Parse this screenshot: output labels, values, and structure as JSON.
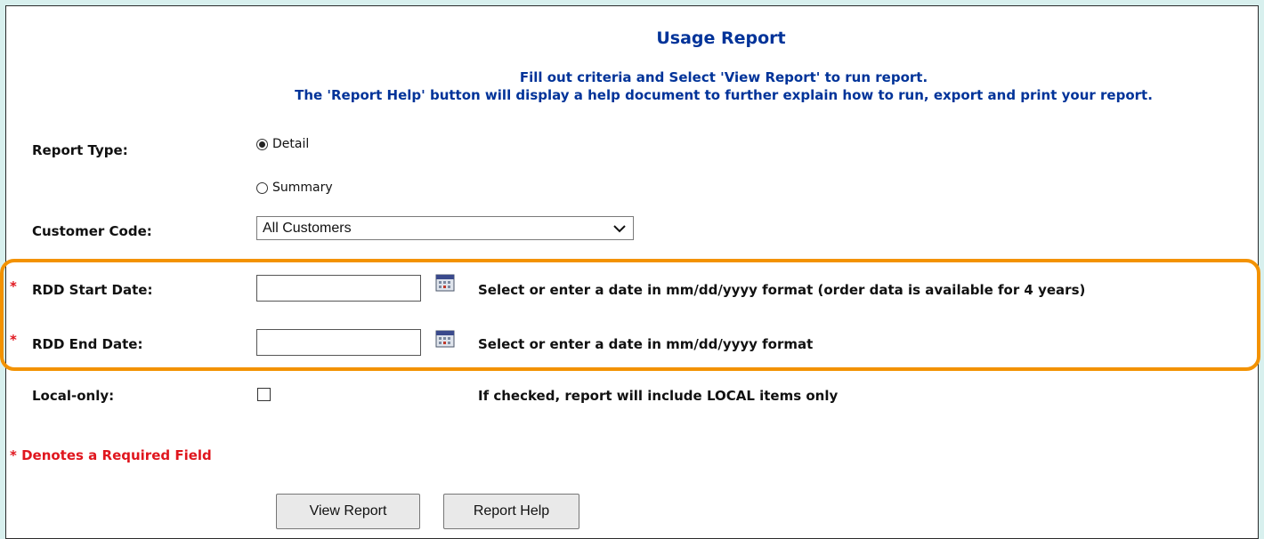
{
  "header": {
    "title": "Usage Report",
    "subtitle_line1": "Fill out criteria and Select 'View Report' to run report.",
    "subtitle_line2": "The 'Report Help' button will display a help document to further explain how to run, export and print your report."
  },
  "form": {
    "report_type": {
      "label": "Report Type:",
      "options": [
        "Detail",
        "Summary"
      ],
      "selected": "Detail"
    },
    "customer_code": {
      "label": "Customer Code:",
      "value": "All Customers"
    },
    "rdd_start": {
      "label": "RDD Start Date:",
      "required_marker": "*",
      "value": "",
      "hint": "Select or enter a date in mm/dd/yyyy format (order data is available for 4 years)"
    },
    "rdd_end": {
      "label": "RDD End Date:",
      "required_marker": "*",
      "value": "",
      "hint": "Select or enter a date in mm/dd/yyyy format"
    },
    "local_only": {
      "label": "Local-only:",
      "checked": false,
      "hint": "If checked, report will include LOCAL items only"
    }
  },
  "required_note": "* Denotes a Required Field",
  "buttons": {
    "view_report": "View Report",
    "report_help": "Report Help"
  },
  "colors": {
    "background": "#d8f0ee",
    "title_blue": "#003399",
    "required_red": "#e0161e",
    "highlight_orange": "#f39200"
  },
  "icons": {
    "calendar": "calendar-icon",
    "select_arrow": "chevron-down-icon"
  }
}
